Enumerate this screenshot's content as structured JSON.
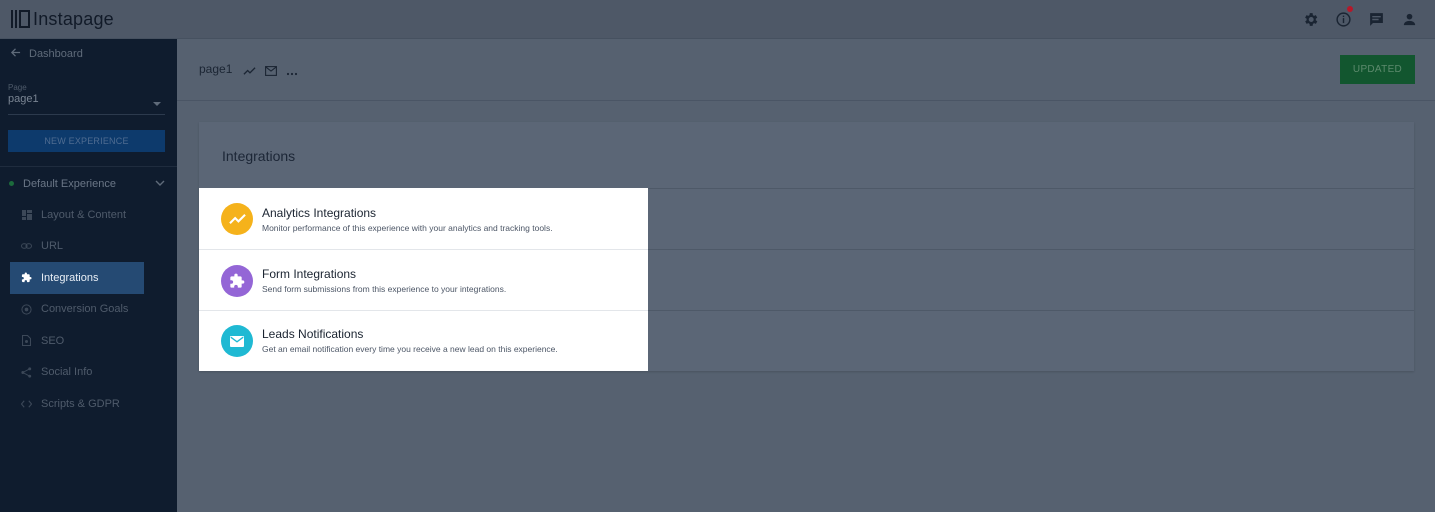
{
  "app": {
    "logo_text": "Instapage"
  },
  "topbar": {
    "icons": [
      "gear-icon",
      "info-icon",
      "chat-icon",
      "user-icon"
    ],
    "notification_color": "#b5182a"
  },
  "sidebar": {
    "back_label": "Dashboard",
    "page_field_label": "Page",
    "page_field_value": "page1",
    "new_experience_label": "NEW EXPERIENCE",
    "experience_label": "Default Experience",
    "experience_status_color": "#1c6b3c",
    "items": [
      {
        "label": "Layout & Content",
        "icon": "layout-icon",
        "active": false
      },
      {
        "label": "URL",
        "icon": "link-icon",
        "active": false
      },
      {
        "label": "Integrations",
        "icon": "puzzle-icon",
        "active": true
      },
      {
        "label": "Conversion Goals",
        "icon": "target-icon",
        "active": false
      },
      {
        "label": "SEO",
        "icon": "document-icon",
        "active": false
      },
      {
        "label": "Social Info",
        "icon": "share-icon",
        "active": false
      },
      {
        "label": "Scripts & GDPR",
        "icon": "code-icon",
        "active": false
      }
    ]
  },
  "header": {
    "page_name": "page1",
    "icons": [
      "analytics-icon",
      "mail-icon",
      "more-icon"
    ],
    "updated_label": "UPDATED"
  },
  "main": {
    "card_title": "Integrations"
  },
  "popover": {
    "items": [
      {
        "title": "Analytics Integrations",
        "description": "Monitor performance of this experience with your analytics and tracking tools.",
        "color": "#f5b21b",
        "icon": "trend-icon"
      },
      {
        "title": "Form Integrations",
        "description": "Send form submissions from this experience to your integrations.",
        "color": "#9466d6",
        "icon": "puzzle-icon"
      },
      {
        "title": "Leads Notifications",
        "description": "Get an email notification every time you receive a new lead on this experience.",
        "color": "#1fb9d3",
        "icon": "mail-icon"
      }
    ]
  }
}
